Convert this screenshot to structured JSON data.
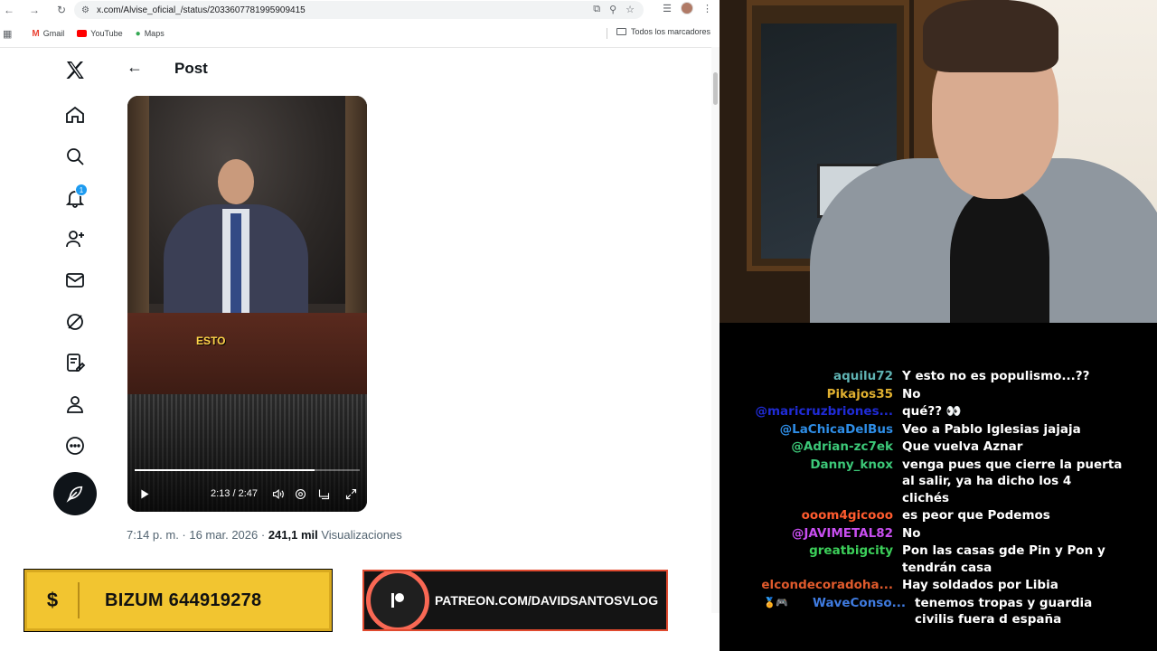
{
  "browser": {
    "url": "x.com/Alvise_oficial_/status/2033607781995909415",
    "bookmarks": [
      {
        "label": "Gmail",
        "icon": "gmail-icon",
        "color": "#ea4335"
      },
      {
        "label": "YouTube",
        "icon": "youtube-icon",
        "color": "#ff0000"
      },
      {
        "label": "Maps",
        "icon": "maps-icon",
        "color": "#34a853"
      }
    ],
    "all_bookmarks": "Todos los marcadores"
  },
  "x": {
    "notification_count": "1",
    "page_title": "Post",
    "video": {
      "caption": "ESTO",
      "time": "2:13 / 2:47",
      "progress": 0.8
    },
    "meta": {
      "time": "7:14 p. m. · 16 mar. 2026 · ",
      "views_count": "241,1 mil",
      "views_label": " Visualizaciones"
    }
  },
  "overlays": {
    "bizum": {
      "symbol": "$",
      "text": "BIZUM 644919278",
      "color": "#f2c530"
    },
    "patreon": {
      "text": "PATREON.COM/DAVIDSANTOSVLOG",
      "accent": "#f96854"
    }
  },
  "chat": [
    {
      "user": "aquilu72",
      "color": "#5fb3b3",
      "text": [
        "Y esto no es populismo...??"
      ],
      "badge": ""
    },
    {
      "user": "Pikajos35",
      "color": "#e0b030",
      "text": [
        "No"
      ],
      "badge": "👁"
    },
    {
      "user": "@maricruzbriones...",
      "color": "#1f2bd6",
      "text": [
        "qué?? 👀"
      ],
      "badge": ""
    },
    {
      "user": "@LaChicaDelBus",
      "color": "#2e8de6",
      "text": [
        "Veo a Pablo Iglesias jajaja"
      ],
      "badge": ""
    },
    {
      "user": "@Adrian-zc7ek",
      "color": "#3cc878",
      "text": [
        "Que vuelva Aznar"
      ],
      "badge": ""
    },
    {
      "user": "Danny_knox",
      "color": "#3cc878",
      "text": [
        "venga pues que cierre la puerta",
        "al salir, ya ha dicho los 4",
        "clichés"
      ],
      "badge": "👁"
    },
    {
      "user": "ooom4gicooo",
      "color": "#ff5b2e",
      "text": [
        "es peor que Podemos"
      ],
      "badge": "👁"
    },
    {
      "user": "@JAVIMETAL82",
      "color": "#c84ef0",
      "text": [
        "No"
      ],
      "badge": ""
    },
    {
      "user": "greatbigcity",
      "color": "#3cd05a",
      "text": [
        "Pon las casas gde Pin y Pon y",
        "tendrán casa"
      ],
      "badge": ""
    },
    {
      "user": "elcondecoradoha...",
      "color": "#e05a2c",
      "text": [
        "Hay soldados por Libia"
      ],
      "badge": ""
    },
    {
      "user": "WaveConso...",
      "color": "#3f7be0",
      "text": [
        "tenemos tropas y guardia",
        "civilis fuera d españa"
      ],
      "badge": "🏅🎮"
    }
  ]
}
